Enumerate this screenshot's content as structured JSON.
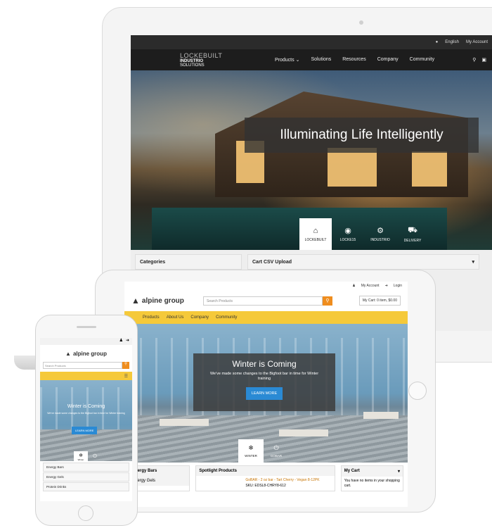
{
  "laptop": {
    "top_bar": {
      "language": "English",
      "account": "My Account"
    },
    "logo": {
      "line1": "LOCKEBUILT",
      "line2": "INDUSTRIO",
      "line3": "SOLUTIONS"
    },
    "nav": [
      "Products ⌄",
      "Solutions",
      "Resources",
      "Company",
      "Community"
    ],
    "hero_title": "Illuminating Life Intelligently",
    "tabs": [
      {
        "icon": "⌂",
        "label": "LOCKEBUILT",
        "active": true
      },
      {
        "icon": "◉",
        "label": "LOCKE15",
        "active": false
      },
      {
        "icon": "⚙",
        "label": "INDUSTRIO",
        "active": false
      },
      {
        "icon": "⛟",
        "label": "DELIVERY",
        "active": false
      }
    ],
    "categories_label": "Categories",
    "cart_csv_label": "Cart CSV Upload"
  },
  "tablet": {
    "top_bar": {
      "account": "My Account",
      "login": "Login"
    },
    "logo_text": "alpine group",
    "search_placeholder": "Search Products",
    "cart_text": "My Cart: 0 item, $0.00",
    "nav": [
      "Products",
      "About Us",
      "Company",
      "Community"
    ],
    "hero": {
      "title": "Winter is Coming",
      "subtitle": "We've made some changes to the Bigfoot bar in time for Winter training",
      "button": "LEARN MORE"
    },
    "tabs": [
      {
        "icon": "❄",
        "label": "WINTER",
        "active": true
      },
      {
        "icon": "⏻",
        "label": "GOBAR",
        "active": false
      }
    ],
    "categories": [
      "Energy Bars",
      "Energy Gels"
    ],
    "spotlight": {
      "heading": "Spotlight Products",
      "product_name": "GoBAR - 2 oz bar - Tart Cherry - Vegan 8-12PK",
      "sku": "SKU: EDSL8-CHRY8-612"
    },
    "my_cart": {
      "heading": "My Cart",
      "empty_text": "You have no items in your shopping cart."
    }
  },
  "phone": {
    "logo_text": "alpine group",
    "search_placeholder": "Search Products",
    "hero": {
      "title": "Winter is Coming",
      "subtitle": "We've made some changes to the Bigfoot bar in time for Winter training",
      "button": "LEARN MORE"
    },
    "tabs": [
      {
        "icon": "❄",
        "label": "Winter",
        "active": true
      },
      {
        "icon": "⏻",
        "label": "",
        "active": false
      }
    ],
    "categories": [
      "Energy Bars",
      "Energy Gels",
      "Protein Drinks"
    ]
  },
  "colors": {
    "accent_yellow": "#f5c93a",
    "accent_orange": "#ef8d1e",
    "button_blue": "#2a8ad4",
    "laptop_nav": "#1d1d1d"
  }
}
